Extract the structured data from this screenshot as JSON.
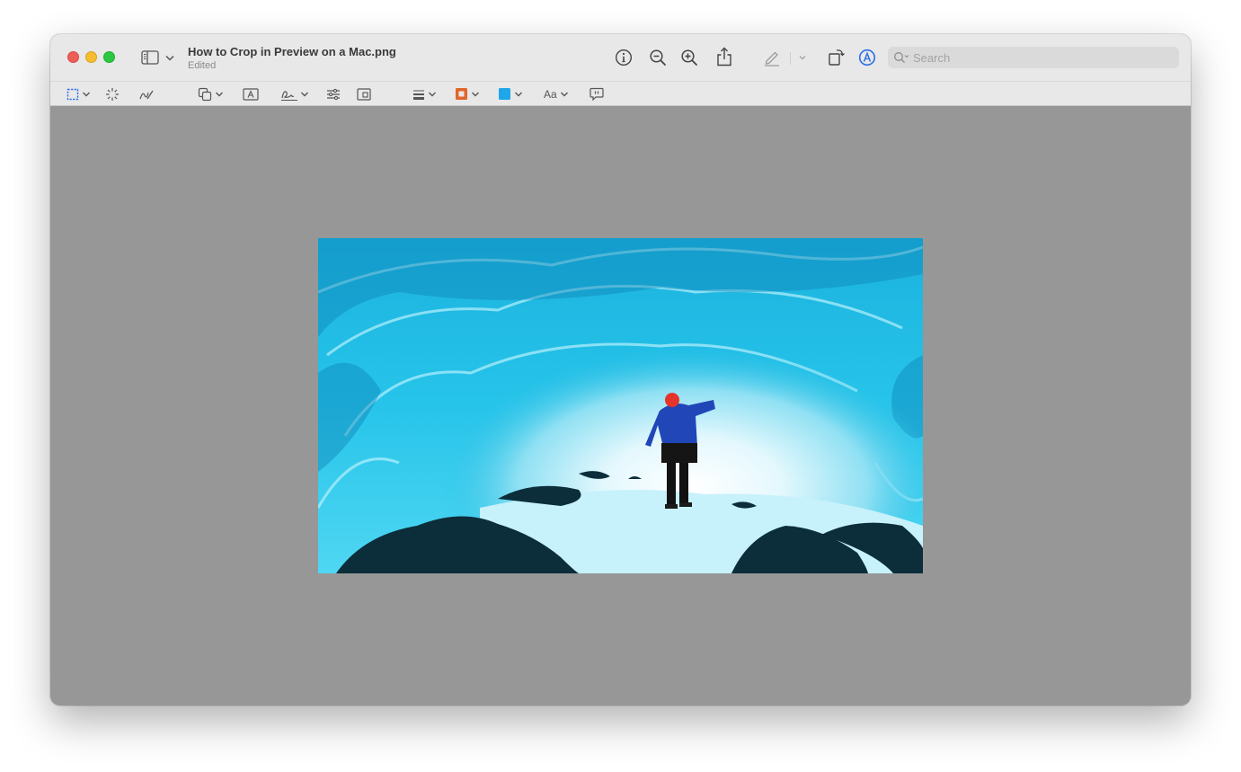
{
  "window": {
    "file_name": "How to Crop in Preview on a Mac.png",
    "status": "Edited"
  },
  "toolbar": {
    "icons": [
      "sidebar-icon",
      "info-icon",
      "zoom-out-icon",
      "zoom-in-icon",
      "share-icon",
      "highlight-pen-icon",
      "rotate-icon",
      "markup-icon",
      "search-icon"
    ]
  },
  "search": {
    "placeholder": "Search"
  },
  "markup_toolbar": {
    "font_button_label": "Aa",
    "icons": [
      "rectangular-selection-icon",
      "instant-alpha-icon",
      "sketch-icon",
      "shapes-icon",
      "text-box-icon",
      "sign-icon",
      "adjust-color-icon",
      "adjust-size-icon",
      "shape-style-icon",
      "border-color-icon",
      "fill-color-icon",
      "text-style-icon",
      "note-icon"
    ],
    "border_color": "#e0662a",
    "fill_color": "#1ea7ea"
  },
  "colors": {
    "canvas_background": "#979797",
    "markup_accent": "#2c6fe6"
  },
  "image": {
    "icon": "ice-cave-photo"
  }
}
